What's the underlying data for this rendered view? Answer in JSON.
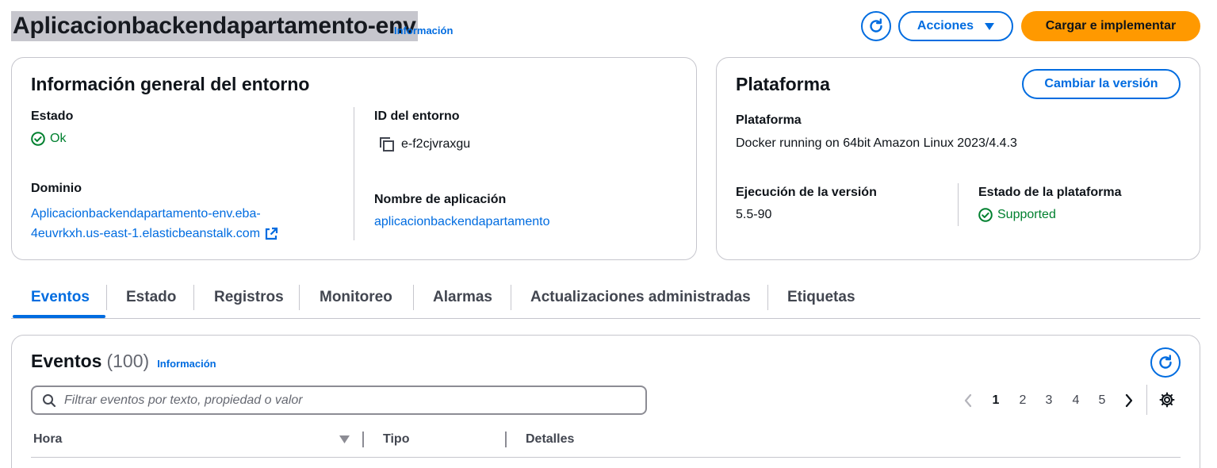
{
  "header": {
    "env_name": "Aplicacionbackendapartamento-env",
    "info_label": "Información",
    "actions_label": "Acciones",
    "deploy_label": "Cargar e implementar"
  },
  "overview": {
    "title": "Información general del entorno",
    "status_key": "Estado",
    "status_value": "Ok",
    "env_id_key": "ID del entorno",
    "env_id_value": "e-f2cjvraxgu",
    "domain_key": "Dominio",
    "domain_line1": "Aplicacionbackendapartamento-env.eba-",
    "domain_line2": "4euvrkxh.us-east-1.elasticbeanstalk.com",
    "app_name_key": "Nombre de aplicación",
    "app_name_value": "aplicacionbackendapartamento"
  },
  "platform": {
    "title": "Plataforma",
    "change_version_label": "Cambiar la versión",
    "platform_key": "Plataforma",
    "platform_value": "Docker running on 64bit Amazon Linux 2023/4.4.3",
    "version_key": "Ejecución de la versión",
    "version_value": "5.5-90",
    "state_key": "Estado de la plataforma",
    "state_value": "Supported"
  },
  "tabs": [
    {
      "label": "Eventos",
      "active": true
    },
    {
      "label": "Estado"
    },
    {
      "label": "Registros"
    },
    {
      "label": "Monitoreo"
    },
    {
      "label": "Alarmas"
    },
    {
      "label": "Actualizaciones administradas"
    },
    {
      "label": "Etiquetas"
    }
  ],
  "events": {
    "title": "Eventos",
    "count": "(100)",
    "info_label": "Información",
    "search_placeholder": "Filtrar eventos por texto, propiedad o valor",
    "pages": [
      "1",
      "2",
      "3",
      "4",
      "5"
    ],
    "current_page": "1",
    "columns": [
      "Hora",
      "Tipo",
      "Detalles"
    ]
  },
  "colors": {
    "link": "#006ce0",
    "primary": "#ff9900",
    "success": "#00802f"
  }
}
